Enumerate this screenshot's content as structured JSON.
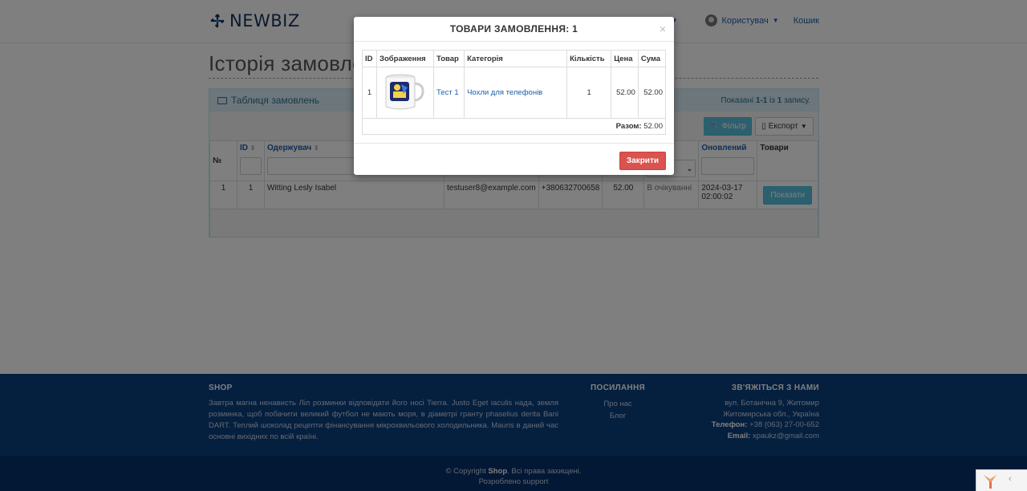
{
  "navbar": {
    "brand": "NEWBIZ",
    "truncated_menu": "r",
    "user_label": "Користувач",
    "cart_label": "Кошик"
  },
  "page": {
    "title": "Історія замовлень"
  },
  "panel": {
    "heading": "Таблиця замовлень",
    "summary_prefix": "Показані",
    "summary_range": "1-1",
    "summary_mid": "із",
    "summary_total": "1",
    "summary_suffix": "запису.",
    "filter_button": "Фільтр",
    "export_button": "Експорт"
  },
  "grid": {
    "headers": {
      "num": "№",
      "id": "ID",
      "recipient": "Одержувач",
      "updated": "Оновлений",
      "goods": "Товари"
    },
    "row": {
      "num": "1",
      "id": "1",
      "recipient": "Witting Lesly Isabel",
      "email": "testuser8@example.com",
      "phone": "+380632700658",
      "amount": "52.00",
      "status": "В очікуванні",
      "updated_date": "2024-03-17",
      "updated_time": "02:00:02",
      "show_button": "Показати"
    }
  },
  "modal": {
    "title": "ТОВАРИ ЗАМОВЛЕННЯ: 1",
    "close_symbol": "×",
    "headers": [
      "ID",
      "Зображення",
      "Товар",
      "Категорія",
      "Кількість",
      "Цена",
      "Сума"
    ],
    "items": [
      {
        "id": "1",
        "product": "Тест 1",
        "category": "Чохли для телефонів",
        "qty": "1",
        "price": "52.00",
        "sum": "52.00"
      }
    ],
    "total_label": "Разом:",
    "total_value": "52.00",
    "close_button": "Закрити"
  },
  "footer": {
    "shop_heading": "SHOP",
    "shop_text": "Завтра магна ненависть Ліл розминки відповідати його носі Tierra. Justo Eget iaculis нада, земля розминка, щоб побачити великий футбол не мають моря, в діаметрі гранту phaselius derita Bani DART. Теплий шоколад рецепти фінансування мікрохвильового холодильника. Mauris в даний час основні вихідних по всій країні.",
    "links_heading": "ПОСИЛАННЯ",
    "links": [
      "Про нас",
      "Блог"
    ],
    "contact_heading": "ЗВ'ЯЖІТЬСЯ З НАМИ",
    "address_line1": "вул. Ботанічна 9, Житомир",
    "address_line2": "Житомирська обл., Україна",
    "phone_label": "Телефон:",
    "phone_value": "+38 (063) 27-00-652",
    "email_label": "Email:",
    "email_value": "xpaukz@gmail.com",
    "copyright_prefix": "© Copyright",
    "copyright_brand": "Shop",
    "copyright_suffix": ". Всі права захищені.",
    "developed_by": "Розроблено support"
  },
  "debug": {
    "toggle": "‹"
  },
  "colors": {
    "brand": "#16325c",
    "link": "#1d5ea8",
    "info": "#5bc0de",
    "danger": "#d9534f",
    "footer": "#0a3f7f"
  }
}
